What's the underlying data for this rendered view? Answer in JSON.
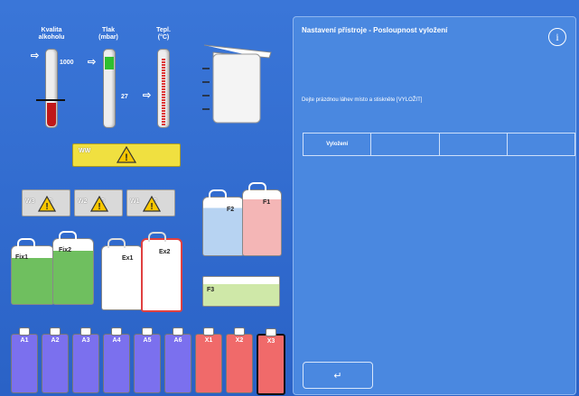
{
  "gauges": {
    "alcohol": {
      "label_line1": "Kvalita",
      "label_line2": "alkoholu",
      "level_pct": 30
    },
    "pressure": {
      "label_line1": "Tlak",
      "label_line2": "(mbar)",
      "value": "1000",
      "level_pct": 88
    },
    "temperature": {
      "label_line1": "Tepl.",
      "label_line2": "(°C)",
      "value": "27",
      "level_pct": 45
    }
  },
  "ww_tray": {
    "label": "WW"
  },
  "wax_baths": [
    {
      "label": "W3",
      "temp": "°C"
    },
    {
      "label": "W2",
      "temp": "°C"
    },
    {
      "label": "W1",
      "temp": "°C"
    }
  ],
  "fix_cans": [
    {
      "label": "Fix1"
    },
    {
      "label": "Fix2"
    }
  ],
  "ex_cans": [
    {
      "label": "Ex1"
    },
    {
      "label": "Ex2"
    }
  ],
  "f_cans": [
    {
      "label": "F2"
    },
    {
      "label": "F1"
    }
  ],
  "f3_tray": {
    "label": "F3"
  },
  "bottles": [
    {
      "label": "A1"
    },
    {
      "label": "A2"
    },
    {
      "label": "A3"
    },
    {
      "label": "A4"
    },
    {
      "label": "A5"
    },
    {
      "label": "A6"
    },
    {
      "label": "X1"
    },
    {
      "label": "X2"
    },
    {
      "label": "X3"
    }
  ],
  "panel": {
    "title": "Nastavení přístroje - Posloupnost vyložení",
    "info_icon": "info-icon",
    "info_glyph": "i",
    "instruction": "Dejte prázdnou láhev místo a stiskněte [VYLOŽIT]",
    "tabs": [
      "Vyložení",
      "",
      "",
      ""
    ],
    "back_icon": "return-arrow-icon",
    "back_glyph": "↵"
  },
  "colors": {
    "background": "#2a64c8",
    "panel": "#4a88e0",
    "reagent_a": "#7b70ee",
    "reagent_x": "#f06a6a",
    "fix": "#6fbf5f",
    "formalin_blue": "#b7d3f2",
    "formalin_pink": "#f4b6b6",
    "ww_yellow": "#f0e040"
  }
}
